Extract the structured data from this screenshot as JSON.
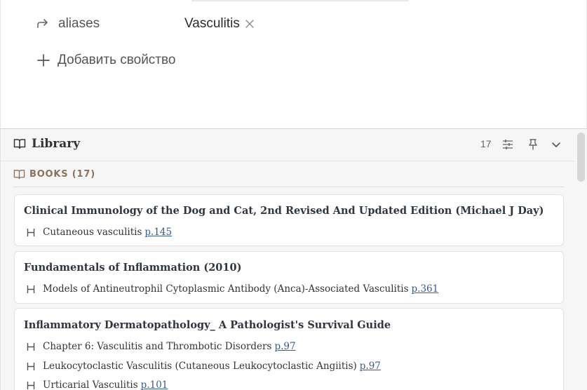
{
  "properties": {
    "aliases_key": "aliases",
    "aliases_value": "Vasculitis",
    "add_property_label": "Добавить свойство"
  },
  "library": {
    "title": "Library",
    "count": "17",
    "section_label": "BOOKS (17)",
    "books": [
      {
        "title": "Clinical Immunology of the Dog and Cat, 2nd Revised And Updated Edition (Michael J Day)",
        "headings": [
          {
            "text": "Cutaneous vasculitis",
            "page": "p.145"
          }
        ]
      },
      {
        "title": "Fundamentals of Inflammation (2010)",
        "headings": [
          {
            "text": "Models of Antineutrophil Cytoplasmic Antibody (Anca)-Associated Vasculitis",
            "page": "p.361"
          }
        ]
      },
      {
        "title": "Inflammatory Dermatopathology_ A Pathologist's Survival Guide",
        "headings": [
          {
            "text": "Chapter 6: Vasculitis and Thrombotic Disorders",
            "page": "p.97"
          },
          {
            "text": "Leukocytoclastic Vasculitis (Cutaneous Leukocytoclastic Angiitis)",
            "page": "p.97"
          },
          {
            "text": "Urticarial Vasculitis",
            "page": "p.101"
          }
        ]
      }
    ]
  },
  "icons": {
    "alias": "arrow-turn-right-icon",
    "remove": "close-icon",
    "add": "plus-icon",
    "library": "open-book-icon",
    "filter": "sliders-icon",
    "pin": "pin-icon",
    "collapse": "chevron-down-icon",
    "heading": "heading-h-icon"
  },
  "colors": {
    "section_accent": "#8a7259",
    "page_link": "#3a5a8c",
    "panel_bg": "#f6f6f6"
  }
}
